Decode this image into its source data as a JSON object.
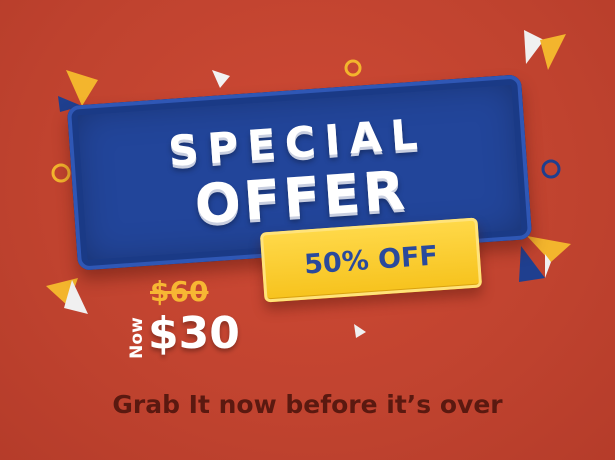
{
  "headline": {
    "line1": "SPECIAL",
    "line2": "OFFER"
  },
  "badge": {
    "text": "50% OFF"
  },
  "pricing": {
    "old_price": "$60",
    "now_label": "Now",
    "new_price": "$30"
  },
  "tagline": "Grab It now before it’s over",
  "colors": {
    "background": "#c0432f",
    "board": "#22459a",
    "badge": "#f6c21c",
    "old_price": "#f7b733",
    "tagline": "#5a1910"
  }
}
